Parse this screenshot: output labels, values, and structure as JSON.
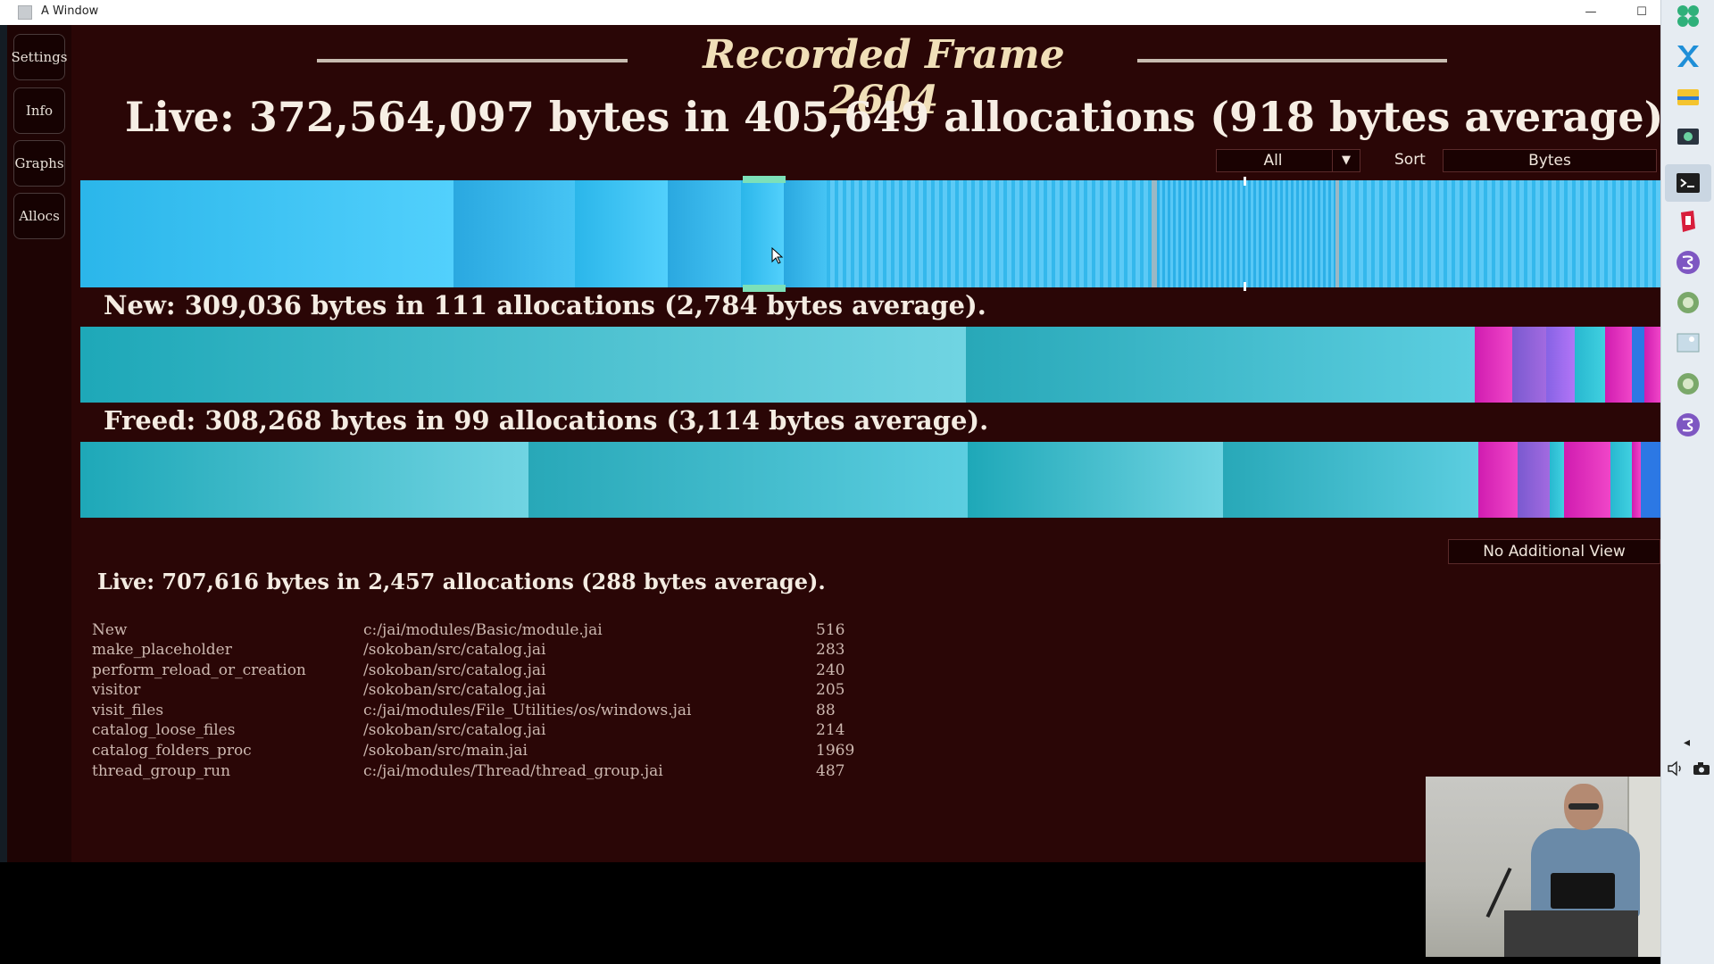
{
  "window": {
    "title": "A Window",
    "minimize": "—",
    "maximize": "☐"
  },
  "sidebar": {
    "items": [
      {
        "label": "Settings"
      },
      {
        "label": "Info"
      },
      {
        "label": "Graphs"
      },
      {
        "label": "Allocs"
      }
    ]
  },
  "frame": {
    "title": "Recorded Frame 2604"
  },
  "live_header": "Live: 372,564,097 bytes in 405,649 allocations (918 bytes average).",
  "controls": {
    "filter_value": "All",
    "filter_arrow": "▼",
    "sort_label": "Sort",
    "sort_value": "Bytes"
  },
  "new_summary": "New: 309,036 bytes in 111 allocations (2,784 bytes average).",
  "freed_summary": "Freed: 308,268 bytes in 99 allocations (3,114 bytes average).",
  "additional_view": "No Additional View",
  "detail": {
    "summary": "Live: 707,616 bytes in 2,457 allocations (288 bytes average).",
    "rows": [
      {
        "proc": "New",
        "file": "c:/jai/modules/Basic/module.jai",
        "line": "516"
      },
      {
        "proc": "make_placeholder",
        "file": "/sokoban/src/catalog.jai",
        "line": "283"
      },
      {
        "proc": "perform_reload_or_creation",
        "file": "/sokoban/src/catalog.jai",
        "line": "240"
      },
      {
        "proc": "visitor",
        "file": "/sokoban/src/catalog.jai",
        "line": "205"
      },
      {
        "proc": "visit_files",
        "file": "c:/jai/modules/File_Utilities/os/windows.jai",
        "line": "88"
      },
      {
        "proc": "catalog_loose_files",
        "file": "/sokoban/src/catalog.jai",
        "line": "214"
      },
      {
        "proc": "catalog_folders_proc",
        "file": "/sokoban/src/main.jai",
        "line": "1969"
      },
      {
        "proc": "thread_group_run",
        "file": "c:/jai/modules/Thread/thread_group.jai",
        "line": "487"
      }
    ]
  },
  "colors": {
    "background": "#2a0606",
    "title_gold": "#f0dfb8",
    "live_blue": "#46c4f4",
    "new_teal": "#5ccee0",
    "magenta": "#e030c0"
  },
  "taskbar": {
    "icons": [
      "app-grid-icon",
      "x-app-icon",
      "file-explorer-icon",
      "display-settings-icon",
      "terminal-icon",
      "red-app-icon",
      "emacs-icon",
      "recycle-icon",
      "image-icon",
      "recycle-icon-2",
      "emacs-icon-2"
    ],
    "tray": [
      "chevron-left-icon",
      "speaker-icon",
      "camera-icon"
    ]
  }
}
